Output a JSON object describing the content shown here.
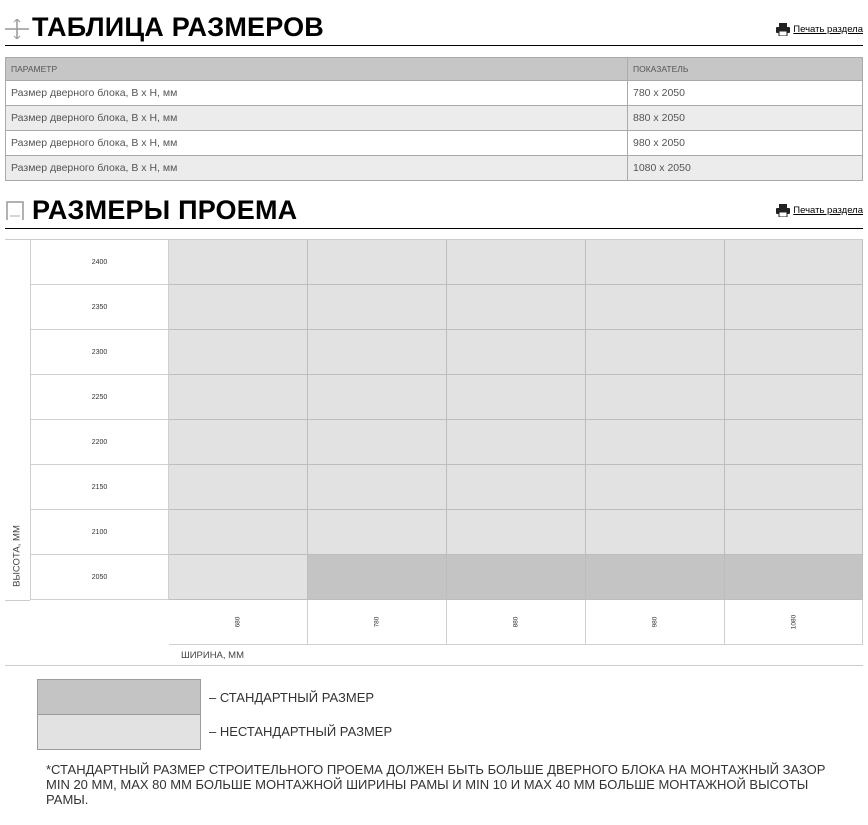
{
  "sections": {
    "size_table": {
      "title": "ТАБЛИЦА РАЗМЕРОВ",
      "print_label": "Печать раздела"
    },
    "opening": {
      "title": "РАЗМЕРЫ ПРОЕМА",
      "print_label": "Печать раздела"
    }
  },
  "size_table": {
    "headers": [
      "ПАРАМЕТР",
      "ПОКАЗАТЕЛЬ"
    ],
    "rows": [
      {
        "param": "Размер дверного блока, В х Н, мм",
        "value": "780 х 2050"
      },
      {
        "param": "Размер дверного блока, В х Н, мм",
        "value": "880 х 2050"
      },
      {
        "param": "Размер дверного блока, В х Н, мм",
        "value": "980 х 2050"
      },
      {
        "param": "Размер дверного блока, В х Н, мм",
        "value": "1080 х 2050"
      }
    ]
  },
  "chart_data": {
    "type": "heatmap",
    "ylabel": "ВЫСОТА, ММ",
    "xlabel": "ШИРИНА, ММ",
    "y": [
      "2400",
      "2350",
      "2300",
      "2250",
      "2200",
      "2150",
      "2100",
      "2050"
    ],
    "x": [
      "680",
      "780",
      "880",
      "980",
      "1080"
    ],
    "cells": [
      [
        "nonstd",
        "nonstd",
        "nonstd",
        "nonstd",
        "nonstd"
      ],
      [
        "nonstd",
        "nonstd",
        "nonstd",
        "nonstd",
        "nonstd"
      ],
      [
        "nonstd",
        "nonstd",
        "nonstd",
        "nonstd",
        "nonstd"
      ],
      [
        "nonstd",
        "nonstd",
        "nonstd",
        "nonstd",
        "nonstd"
      ],
      [
        "nonstd",
        "nonstd",
        "nonstd",
        "nonstd",
        "nonstd"
      ],
      [
        "nonstd",
        "nonstd",
        "nonstd",
        "nonstd",
        "nonstd"
      ],
      [
        "nonstd",
        "nonstd",
        "nonstd",
        "nonstd",
        "nonstd"
      ],
      [
        "nonstd",
        "std",
        "std",
        "std",
        "std"
      ]
    ],
    "colors": {
      "std": "#c4c4c4",
      "nonstd": "#e2e2e2"
    }
  },
  "legend": {
    "standard": "– СТАНДАРТНЫЙ РАЗМЕР",
    "nonstandard": "– НЕСТАНДАРТНЫЙ РАЗМЕР"
  },
  "footnote": "*СТАНДАРТНЫЙ РАЗМЕР СТРОИТЕЛЬНОГО ПРОЕМА ДОЛЖЕН БЫТЬ БОЛЬШЕ ДВЕРНОГО БЛОКА НА МОНТАЖНЫЙ ЗАЗОР MIN 20 ММ, MAX  80 ММ БОЛЬШЕ МОНТАЖНОЙ ШИРИНЫ РАМЫ И MIN 10 И MAX 40 ММ БОЛЬШЕ МОНТАЖНОЙ ВЫСОТЫ РАМЫ."
}
